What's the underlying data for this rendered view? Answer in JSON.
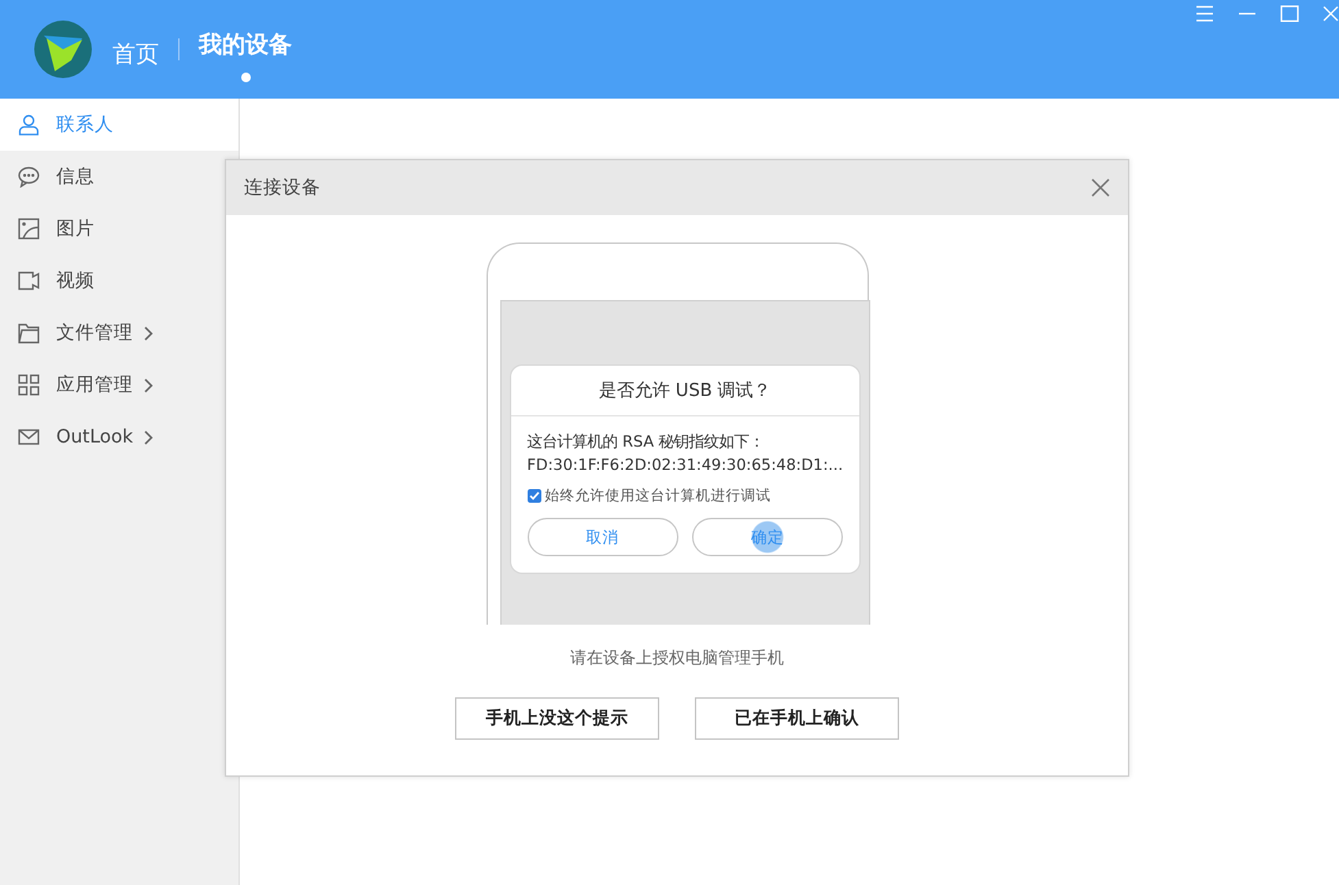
{
  "header": {
    "tabs": [
      {
        "label": "首页",
        "selected": false
      },
      {
        "label": "我的设备",
        "selected": true
      }
    ]
  },
  "sidebar": {
    "items": [
      {
        "label": "联系人",
        "selected": true,
        "has_submenu": false
      },
      {
        "label": "信息",
        "selected": false,
        "has_submenu": false
      },
      {
        "label": "图片",
        "selected": false,
        "has_submenu": false
      },
      {
        "label": "视频",
        "selected": false,
        "has_submenu": false
      },
      {
        "label": "文件管理",
        "selected": false,
        "has_submenu": true
      },
      {
        "label": "应用管理",
        "selected": false,
        "has_submenu": true
      },
      {
        "label": "OutLook",
        "selected": false,
        "has_submenu": true
      }
    ]
  },
  "dialog": {
    "title": "连接设备",
    "phone_prompt": {
      "title": "是否允许 USB 调试？",
      "message": "这台计算机的 RSA 秘钥指纹如下：",
      "fingerprint": "FD:30:1F:F6:2D:02:31:49:30:65:48:D1:...",
      "checkbox": {
        "label": "始终允许使用这台计算机进行调试",
        "checked": true
      },
      "buttons": [
        "取消",
        "确定"
      ]
    },
    "hint": "请在设备上授权电脑管理手机",
    "buttons": [
      "手机上没这个提示",
      "已在手机上确认"
    ]
  }
}
